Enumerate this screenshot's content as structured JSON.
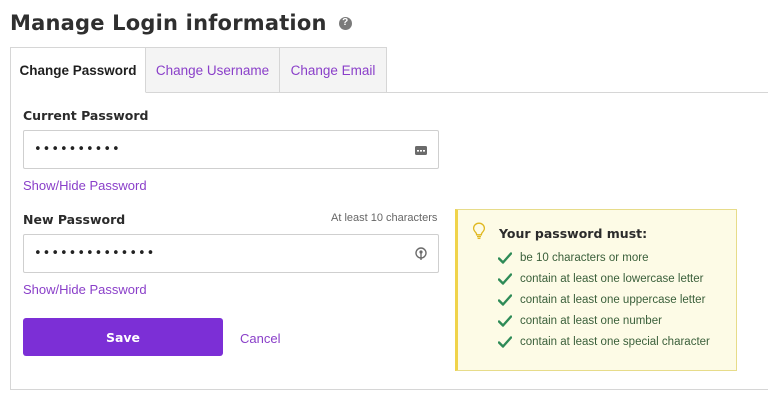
{
  "header": {
    "title": "Manage Login information",
    "help_icon": "help-circle-icon"
  },
  "tabs": [
    {
      "label": "Change Password",
      "active": true
    },
    {
      "label": "Change Username",
      "active": false
    },
    {
      "label": "Change Email",
      "active": false
    }
  ],
  "form": {
    "current_password": {
      "label": "Current Password",
      "value": "••••••••••",
      "icon": "password-manager-icon"
    },
    "show_hide_current": "Show/Hide Password",
    "new_password": {
      "label": "New Password",
      "hint": "At least 10 characters",
      "value": "••••••••••••••",
      "icon": "password-key-icon"
    },
    "show_hide_new": "Show/Hide Password",
    "save_label": "Save",
    "cancel_label": "Cancel"
  },
  "requirements": {
    "title": "Your password must:",
    "icon": "lightbulb-icon",
    "items": [
      "be 10 characters or more",
      "contain at least one lowercase letter",
      "contain at least one uppercase letter",
      "contain at least one number",
      "contain at least one special character"
    ],
    "check_color": "#2e8b57",
    "accent_color": "#f0d34a"
  },
  "colors": {
    "primary": "#7c2fd6",
    "link": "#8a3fc9"
  }
}
